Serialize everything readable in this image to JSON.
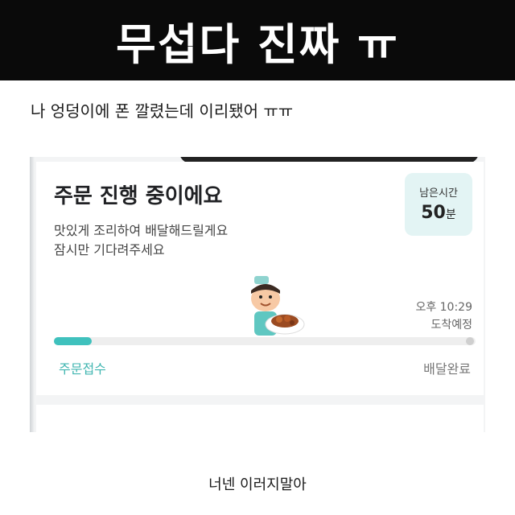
{
  "banner": {
    "title": "무섭다 진짜 ㅠ"
  },
  "caption": "나 엉덩이에 폰 깔렸는데 이리됐어 ㅠㅠ",
  "order": {
    "title": "주문 진행 중이에요",
    "sub_line1": "맛있게 조리하여 배달해드릴게요",
    "sub_line2": "잠시만 기다려주세요",
    "remaining_label": "남은시간",
    "remaining_value": "50",
    "remaining_unit": "분",
    "eta_time": "오후 10:29",
    "eta_label": "도착예정",
    "progress_fraction": 0.09,
    "step_start": "주문접수",
    "step_end": "배달완료"
  },
  "colors": {
    "accent": "#3fc1bd",
    "banner_bg": "#0a0a0a",
    "time_box_bg": "#e3f4f4"
  },
  "footer": "너넨 이러지말아"
}
